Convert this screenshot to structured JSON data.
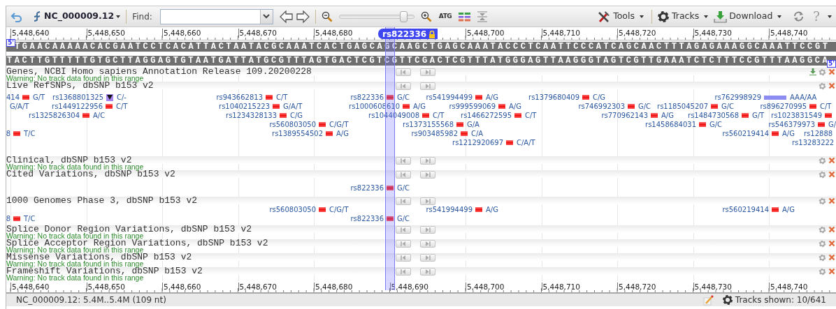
{
  "toolbar": {
    "sequence_menu": "NC_000009.12",
    "find_label": "Find:",
    "zoom_slider": {
      "level": 0.9
    },
    "sequence_button": "ATG",
    "menus": [
      "Tools",
      "Tracks",
      "Download"
    ],
    "help": "?"
  },
  "ruler": {
    "ticks": [
      "5,448,640",
      "5,448,650",
      "5,448,660",
      "5,448,670",
      "5,448,680",
      "5,448,700",
      "5,448,710",
      "5,448,720",
      "5,448,730",
      "5,448,740"
    ],
    "marker": {
      "label": "rs822336",
      "locked": true
    }
  },
  "sequence": {
    "forward": "TGAACAAAAACACGAATCCTCACATTACTAATACGCAAATCACTGAGCAGCAAGCTGAGCAAATACCCTCAATTCCCATCAGCAACTTTAGAGAAAGGCAAATTCCGT",
    "reverse": "TACTTGTTTTTGTGCTTAGGAGTGTAATGATTATGCGTTTAGTGACTCGTCGTTCGACTCGTTTATGGGAGTTAAGGGTAGTCGTTGAAATCTCTTTCCGTTTAAGGCA",
    "forward_end": "5'",
    "reverse_end": "5'"
  },
  "tracks": [
    {
      "title": "Genes, NCBI Homo sapiens Annotation Release 109.20200228",
      "warning": "Warning: No track data found in this range",
      "downloadable": true
    },
    {
      "title": "Live RefSNPs, dbSNP b153 v2",
      "downloadable": false,
      "lanes": [
        {
          "features": [
            {
              "id": "414",
              "kind": "snv",
              "alleles": "G/T"
            },
            {
              "id": "rs1368801325",
              "kind": "deletion",
              "alleles": "C/-"
            },
            {
              "id": "rs943662813",
              "kind": "snv",
              "alleles": "C/T"
            },
            {
              "id": "rs822336",
              "kind": "snv",
              "alleles": "G/C"
            },
            {
              "id": "rs541994499",
              "kind": "snv",
              "alleles": "A/G"
            },
            {
              "id": "rs1379680409",
              "kind": "snv",
              "alleles": "C/G"
            },
            {
              "id": "rs762998929",
              "kind": "indel",
              "alleles": "AAA/AA"
            }
          ]
        },
        {
          "features": [
            {
              "kind": "alleles-only",
              "alleles": "G/A/T"
            },
            {
              "id": "rs1449122956",
              "kind": "snv",
              "alleles": "C/T"
            },
            {
              "id": "rs1040215223",
              "kind": "snv",
              "alleles": "G/A/T"
            },
            {
              "id": "rs1000608610",
              "kind": "snv",
              "alleles": "A/G"
            },
            {
              "id": "rs999599069",
              "kind": "snv",
              "alleles": "A/G"
            },
            {
              "id": "rs746992303",
              "kind": "snv",
              "alleles": "G/C"
            },
            {
              "id": "rs1185045207",
              "kind": "snv",
              "alleles": "G/C"
            },
            {
              "id": "rs896270995",
              "kind": "snv",
              "alleles": "C/T"
            }
          ]
        },
        {
          "features": [
            {
              "id": "rs1325826304",
              "kind": "snv",
              "alleles": "A/C"
            },
            {
              "id": "rs1234328133",
              "kind": "snv",
              "alleles": "C/G"
            },
            {
              "id": "rs1044049008",
              "kind": "snv",
              "alleles": "C/T"
            },
            {
              "id": "rs1466272595",
              "kind": "snv",
              "alleles": "C/T"
            },
            {
              "id": "rs770962143",
              "kind": "snv",
              "alleles": "A/G"
            },
            {
              "id": "rs1484730568",
              "kind": "snv",
              "alleles": "G/T"
            },
            {
              "id": "rs1023831549",
              "kind": "snv"
            }
          ]
        },
        {
          "features": [
            {
              "id": "rs560803050",
              "kind": "snv",
              "alleles": "C/G/T"
            },
            {
              "id": "rs1373155568",
              "kind": "snv",
              "alleles": "G/A"
            },
            {
              "id": "rs1458684031",
              "kind": "snv",
              "alleles": "G/C"
            },
            {
              "id": "rs546379973",
              "kind": "snv",
              "alleles": "G/"
            }
          ]
        },
        {
          "features": [
            {
              "id": "8",
              "kind": "snv",
              "alleles": "T/C"
            },
            {
              "id": "rs1389554502",
              "kind": "snv",
              "alleles": "A/G"
            },
            {
              "id": "rs903485982",
              "kind": "snv",
              "alleles": "C/A"
            },
            {
              "id": "rs560219414",
              "kind": "snv",
              "alleles": "A/G"
            },
            {
              "id": "rs12888",
              "kind": "id-only"
            }
          ]
        },
        {
          "features": [
            {
              "id": "rs1212920697",
              "kind": "snv",
              "alleles": "C/A/T"
            },
            {
              "id": "rs13283222",
              "kind": "id-only"
            }
          ]
        }
      ]
    },
    {
      "title": "Clinical, dbSNP b153 v2",
      "warning": "Warning: No track data found in this range",
      "downloadable": false
    },
    {
      "title": "Cited Variations, dbSNP b153 v2",
      "downloadable": false,
      "lanes": [
        {
          "features": [
            {
              "id": "rs822336",
              "kind": "snv",
              "alleles": "G/C"
            }
          ]
        }
      ]
    },
    {
      "title": "1000 Genomes Phase 3, dbSNP b153 v2",
      "downloadable": false,
      "lanes": [
        {
          "features": [
            {
              "id": "rs560803050",
              "kind": "snv",
              "alleles": "C/G/T"
            },
            {
              "id": "rs541994499",
              "kind": "snv",
              "alleles": "A/G"
            },
            {
              "id": "rs560219414",
              "kind": "snv",
              "alleles": "A/G"
            }
          ]
        },
        {
          "features": [
            {
              "id": "8",
              "kind": "snv",
              "alleles": "T/C"
            },
            {
              "id": "rs822336",
              "kind": "snv",
              "alleles": "G/C"
            }
          ]
        }
      ]
    },
    {
      "title": "Splice Donor Region Variations, dbSNP b153 v2",
      "warning": "Warning: No track data found in this range",
      "downloadable": false
    },
    {
      "title": "Splice Acceptor Region Variations, dbSNP b153 v2",
      "warning": "Warning: No track data found in this range",
      "downloadable": false
    },
    {
      "title": "Missense Variations, dbSNP b153 v2",
      "warning": "Warning: No track data found in this range",
      "downloadable": false
    },
    {
      "title": "Frameshift Variations, dbSNP b153 v2",
      "warning": "Warning: No track data found in this range",
      "downloadable": false
    }
  ],
  "bottom_ruler": {
    "ticks": [
      "5,448,640",
      "5,448,650",
      "5,448,660",
      "5,448,670",
      "5,448,680",
      "5,448,690",
      "5,448,700",
      "5,448,710",
      "5,448,720",
      "5,448,730",
      "5,448,740"
    ]
  },
  "status_bar": {
    "location": "NC_000009.12: 5.4M..5.4M (109 nt)",
    "tracks_shown": "Tracks shown: 10/641"
  }
}
